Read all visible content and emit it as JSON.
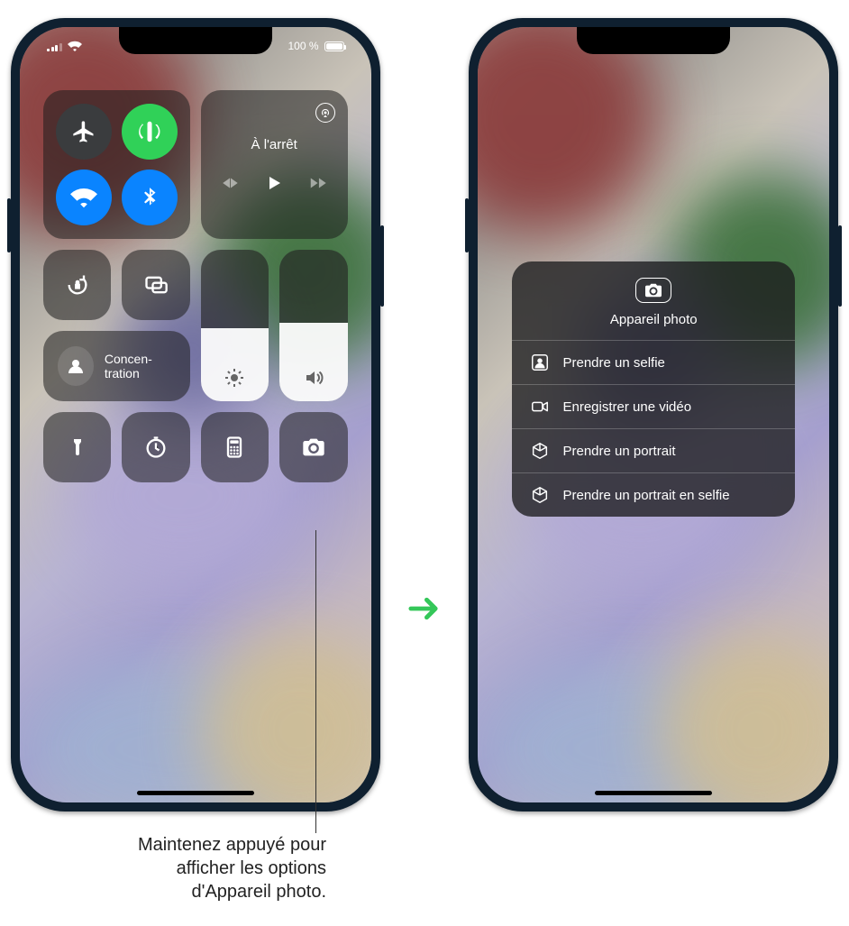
{
  "status": {
    "battery_pct": "100 %"
  },
  "control_center": {
    "media_status": "À l'arrêt",
    "focus_label": "Concen­tration"
  },
  "camera_menu": {
    "title": "Appareil photo",
    "items": [
      {
        "label": "Prendre un selfie"
      },
      {
        "label": "Enregistrer une vidéo"
      },
      {
        "label": "Prendre un portrait"
      },
      {
        "label": "Prendre un portrait en selfie"
      }
    ]
  },
  "callout": {
    "line1": "Maintenez appuyé pour",
    "line2": "afficher les options",
    "line3": "d'Appareil photo."
  },
  "icons": {
    "airplane": "airplane-icon",
    "cellular_data": "cellular-data-icon",
    "wifi": "wifi-icon",
    "bluetooth": "bluetooth-icon",
    "airplay": "airplay-icon",
    "prev": "previous-track-icon",
    "play": "play-icon",
    "next": "next-track-icon",
    "orientation_lock": "orientation-lock-icon",
    "screen_mirror": "screen-mirroring-icon",
    "focus": "focus-person-icon",
    "brightness": "brightness-icon",
    "volume": "volume-icon",
    "flashlight": "flashlight-icon",
    "timer": "timer-icon",
    "calculator": "calculator-icon",
    "camera": "camera-icon",
    "selfie_person": "person-in-frame-icon",
    "video": "video-camera-icon",
    "cube": "cube-icon"
  }
}
